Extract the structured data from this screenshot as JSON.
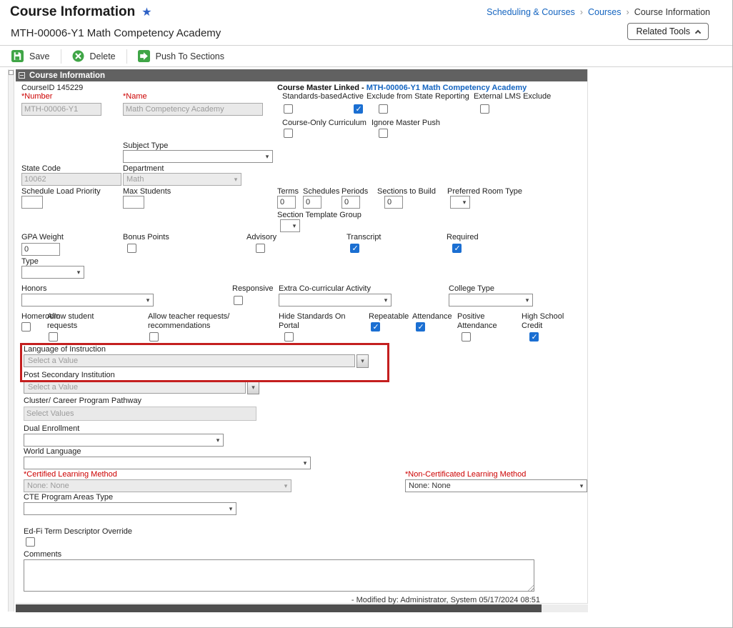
{
  "header": {
    "title": "Course Information",
    "subtitle": "MTH-00006-Y1 Math Competency Academy",
    "breadcrumb": {
      "items": [
        "Scheduling & Courses",
        "Courses",
        "Course Information"
      ],
      "separator": "›"
    },
    "related_tools_label": "Related Tools"
  },
  "toolbar": {
    "save_label": "Save",
    "delete_label": "Delete",
    "push_label": "Push To Sections"
  },
  "panel": {
    "title": "Course Information",
    "course_id": "CourseID 145229",
    "course_master_label": "Course Master Linked - ",
    "course_master_link": "MTH-00006-Y1 Math Competency Academy",
    "modified_note": "- Modified by: Administrator, System 05/17/2024 08:51"
  },
  "fields": {
    "number": {
      "label": "*Number",
      "value": "MTH-00006-Y1"
    },
    "name": {
      "label": "*Name",
      "value": "Math Competency Academy"
    },
    "subject_type": {
      "label": "Subject Type",
      "value": ""
    },
    "state_code": {
      "label": "State Code",
      "value": "10062"
    },
    "department": {
      "label": "Department",
      "value": "Math"
    },
    "schedule_load_priority": {
      "label": "Schedule Load Priority",
      "value": ""
    },
    "max_students": {
      "label": "Max Students",
      "value": ""
    },
    "terms": {
      "label": "Terms",
      "value": "0"
    },
    "schedules": {
      "label": "Schedules",
      "value": "0"
    },
    "periods": {
      "label": "Periods",
      "value": "0"
    },
    "sections_to_build": {
      "label": "Sections to Build",
      "value": "0"
    },
    "preferred_room_type": {
      "label": "Preferred Room Type",
      "value": ""
    },
    "section_template_group": {
      "label": "Section Template Group",
      "value": ""
    },
    "gpa_weight": {
      "label": "GPA Weight",
      "value": "0"
    },
    "type": {
      "label": "Type",
      "value": ""
    },
    "honors": {
      "label": "Honors",
      "value": ""
    },
    "extra_cocurricular": {
      "label": "Extra Co-curricular Activity",
      "value": ""
    },
    "college_type": {
      "label": "College Type",
      "value": ""
    },
    "language_of_instruction": {
      "label": "Language of Instruction",
      "value": "Select a Value"
    },
    "post_secondary_institution": {
      "label": "Post Secondary Institution",
      "value": "Select a Value"
    },
    "cluster_pathway": {
      "label": "Cluster/ Career Program Pathway",
      "placeholder": "Select Values"
    },
    "dual_enrollment": {
      "label": "Dual Enrollment",
      "value": ""
    },
    "world_language": {
      "label": "World Language",
      "value": ""
    },
    "certified_learning_method": {
      "label": "*Certified Learning Method",
      "value": "None: None"
    },
    "non_certificated_learning_method": {
      "label": "*Non-Certificated Learning Method",
      "value": "None: None"
    },
    "cte_program_areas_type": {
      "label": "CTE Program Areas Type",
      "value": ""
    },
    "edfi_term_descriptor_override": {
      "label": "Ed-Fi Term Descriptor Override",
      "checked": false
    },
    "comments": {
      "label": "Comments",
      "value": ""
    }
  },
  "checkboxes": {
    "standards_based": {
      "label": "Standards-based",
      "checked": false
    },
    "active": {
      "label": "Active",
      "checked": true
    },
    "exclude_state_reporting": {
      "label": "Exclude from State Reporting",
      "checked": false
    },
    "external_lms_exclude": {
      "label": "External LMS Exclude",
      "checked": false
    },
    "course_only_curriculum": {
      "label": "Course-Only Curriculum",
      "checked": false
    },
    "ignore_master_push": {
      "label": "Ignore Master Push",
      "checked": false
    },
    "bonus_points": {
      "label": "Bonus Points",
      "checked": false
    },
    "advisory": {
      "label": "Advisory",
      "checked": false
    },
    "transcript": {
      "label": "Transcript",
      "checked": true
    },
    "required": {
      "label": "Required",
      "checked": true
    },
    "responsive": {
      "label": "Responsive",
      "checked": false
    },
    "homeroom": {
      "label": "Homeroom",
      "checked": false
    },
    "allow_student_requests": {
      "label": "Allow student requests",
      "checked": false
    },
    "allow_teacher_requests": {
      "label": "Allow teacher requests/ recommendations",
      "checked": false
    },
    "hide_standards_on_portal": {
      "label": "Hide Standards On Portal",
      "checked": false
    },
    "repeatable": {
      "label": "Repeatable",
      "checked": true
    },
    "attendance": {
      "label": "Attendance",
      "checked": true
    },
    "positive_attendance": {
      "label": "Positive Attendance",
      "checked": false
    },
    "high_school_credit": {
      "label": "High School Credit",
      "checked": true
    }
  },
  "colors": {
    "toolbar_green": "#3fa546",
    "checkbox_blue": "#1b6fd2",
    "link_blue": "#1565c0",
    "required_red": "#cc0000",
    "annotation_red": "#c41f1f",
    "panel_header_gray": "#616161"
  }
}
